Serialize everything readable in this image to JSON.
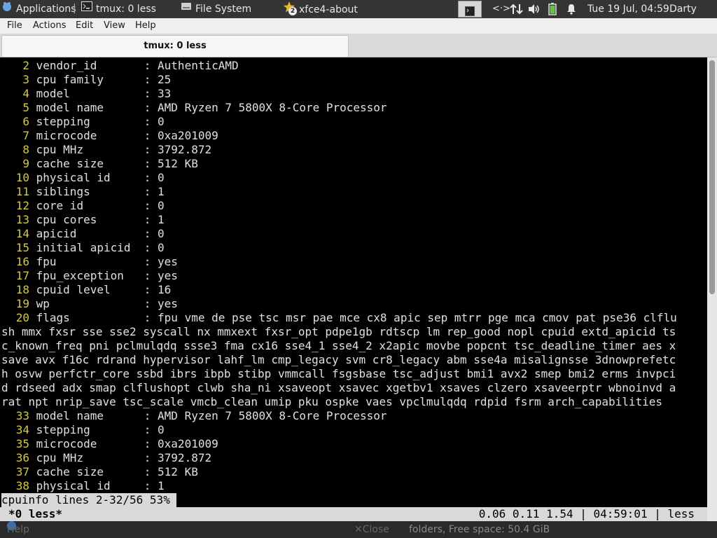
{
  "panel": {
    "tasks": [
      {
        "label": "Applications",
        "icon": "xfce-mouse-icon"
      },
      {
        "label": "tmux: 0 less",
        "icon": "terminal-icon"
      },
      {
        "label": "File System",
        "icon": "drive-icon"
      },
      {
        "label": "xfce4-about",
        "icon": "star-icon",
        "badge": "2"
      }
    ],
    "clock": "Tue 19 Jul, 04:59",
    "user": "Darty uwu"
  },
  "window": {
    "menu": [
      "File",
      "Actions",
      "Edit",
      "View",
      "Help"
    ],
    "tab_title": "tmux: 0 less"
  },
  "terminal": {
    "lines": [
      {
        "n": "2",
        "text": "vendor_id       : AuthenticAMD"
      },
      {
        "n": "3",
        "text": "cpu family      : 25"
      },
      {
        "n": "4",
        "text": "model           : 33"
      },
      {
        "n": "5",
        "text": "model name      : AMD Ryzen 7 5800X 8-Core Processor"
      },
      {
        "n": "6",
        "text": "stepping        : 0"
      },
      {
        "n": "7",
        "text": "microcode       : 0xa201009"
      },
      {
        "n": "8",
        "text": "cpu MHz         : 3792.872"
      },
      {
        "n": "9",
        "text": "cache size      : 512 KB"
      },
      {
        "n": "10",
        "text": "physical id     : 0"
      },
      {
        "n": "11",
        "text": "siblings        : 1"
      },
      {
        "n": "12",
        "text": "core id         : 0"
      },
      {
        "n": "13",
        "text": "cpu cores       : 1"
      },
      {
        "n": "14",
        "text": "apicid          : 0"
      },
      {
        "n": "15",
        "text": "initial apicid  : 0"
      },
      {
        "n": "16",
        "text": "fpu             : yes"
      },
      {
        "n": "17",
        "text": "fpu_exception   : yes"
      },
      {
        "n": "18",
        "text": "cpuid level     : 16"
      },
      {
        "n": "19",
        "text": "wp              : yes"
      },
      {
        "n": "20",
        "text": "flags           : fpu vme de pse tsc msr pae mce cx8 apic sep mtrr pge mca cmov pat pse36 clflu"
      },
      {
        "n": "",
        "text": "sh mmx fxsr sse sse2 syscall nx mmxext fxsr_opt pdpe1gb rdtscp lm rep_good nopl cpuid extd_apicid ts"
      },
      {
        "n": "",
        "text": "c_known_freq pni pclmulqdq ssse3 fma cx16 sse4_1 sse4_2 x2apic movbe popcnt tsc_deadline_timer aes x"
      },
      {
        "n": "",
        "text": "save avx f16c rdrand hypervisor lahf_lm cmp_legacy svm cr8_legacy abm sse4a misalignsse 3dnowprefetc"
      },
      {
        "n": "",
        "text": "h osvw perfctr_core ssbd ibrs ibpb stibp vmmcall fsgsbase tsc_adjust bmi1 avx2 smep bmi2 erms invpci"
      },
      {
        "n": "",
        "text": "d rdseed adx smap clflushopt clwb sha_ni xsaveopt xsavec xgetbv1 xsaves clzero xsaveerptr wbnoinvd a"
      },
      {
        "n": "",
        "text": "rat npt nrip_save tsc_scale vmcb_clean umip pku ospke vaes vpclmulqdq rdpid fsrm arch_capabilities"
      },
      {
        "n": "33",
        "text": "model name      : AMD Ryzen 7 5800X 8-Core Processor"
      },
      {
        "n": "34",
        "text": "stepping        : 0"
      },
      {
        "n": "35",
        "text": "microcode       : 0xa201009"
      },
      {
        "n": "36",
        "text": "cpu MHz         : 3792.872"
      },
      {
        "n": "37",
        "text": "cache size      : 512 KB"
      },
      {
        "n": "38",
        "text": "physical id     : 1"
      }
    ],
    "less_status": "cpuinfo lines 2-32/56 53%",
    "tmux_left": "*0 less*",
    "tmux_right": "0.06 0.11 1.54 | 04:59:01 | less"
  },
  "behind": {
    "help_label": "Help",
    "close_label": "Close",
    "status": "folders, Free space: 50.4 GiB"
  }
}
